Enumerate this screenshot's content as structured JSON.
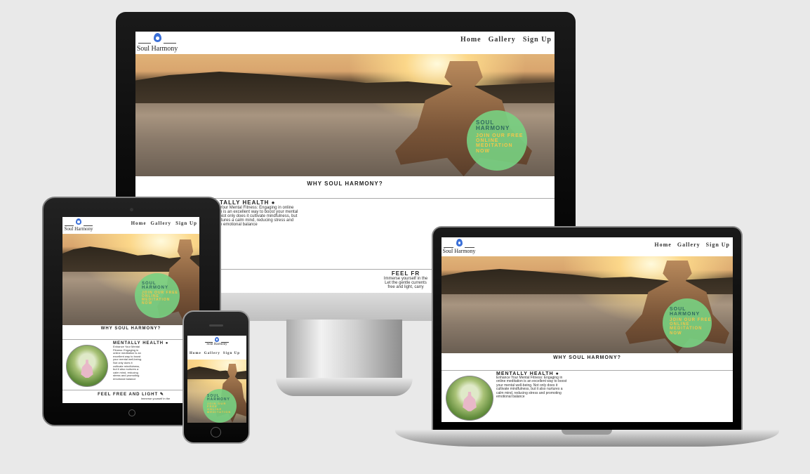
{
  "site": {
    "logo_text": "Soul Harmony",
    "nav": [
      "Home",
      "Gallery",
      "Sign Up"
    ],
    "hero_title": "SOUL HARMONY",
    "hero_cta": "JOIN OUR FREE ONLINE MEDITATION NOW",
    "hero_cta_lines": [
      "JOIN OUR FREE",
      "ONLINE",
      "MEDITATION",
      "NOW"
    ],
    "why_heading": "WHY SOUL HARMONY?",
    "feature1_title": "MENTALLY HEALTH",
    "feature1_icon": "brain-icon",
    "feature1_text": "Enhance Your Mental Fitness: Engaging in online meditation is an excellent way to boost your mental well-being. Not only does it cultivate mindfulness, but it also nurtures a calm mind, reducing stress and promoting emotional balance",
    "feature2_title": "FEEL FREE AND LIGHT",
    "feature2_icon": "feather-icon",
    "feature2_text": "Immerse yourself in the ... Let the gentle currents ... free and light, carry"
  },
  "monitor_crop": {
    "feature1_title": "TALLY HEALTH",
    "feature1_lines": [
      "Your Mental Fitness: Engaging in online",
      "n is an excellent way to boost your mental",
      "Not only does it cultivate mindfulness, but",
      "rtures a calm mind, reducing stress and",
      "e emotional balance"
    ],
    "feature2_title": "FEEL FR",
    "feature2_lines": [
      "Immerse yourself in the",
      "Let the gentle currents",
      "free and light, carry"
    ]
  },
  "tablet_crop": {
    "feature1_lines": [
      "Enhance Your Mental",
      "Fitness: Engaging in",
      "online meditation is an",
      "excellent way to boost",
      "your mental well-being.",
      "Not only does it",
      "cultivate mindfulness,",
      "but it also nurtures a",
      "calm mind, reducing",
      "stress and promoting",
      "emotional balance"
    ],
    "feature2_line": "Immerse yourself in the"
  },
  "laptop_crop": {
    "feature1_lines": [
      "Enhance Your Mental Fitness: Engaging in",
      "online meditation is an excellent way to boost",
      "your mental well-being. Not only does it",
      "cultivate mindfulness, but it also nurtures a",
      "calm mind, reducing stress and promoting",
      "emotional balance"
    ]
  },
  "colors": {
    "background": "#e9e9e9",
    "cta_circle": "#78d282",
    "cta_title": "#2f6b5e",
    "cta_text": "#f3c64a"
  }
}
